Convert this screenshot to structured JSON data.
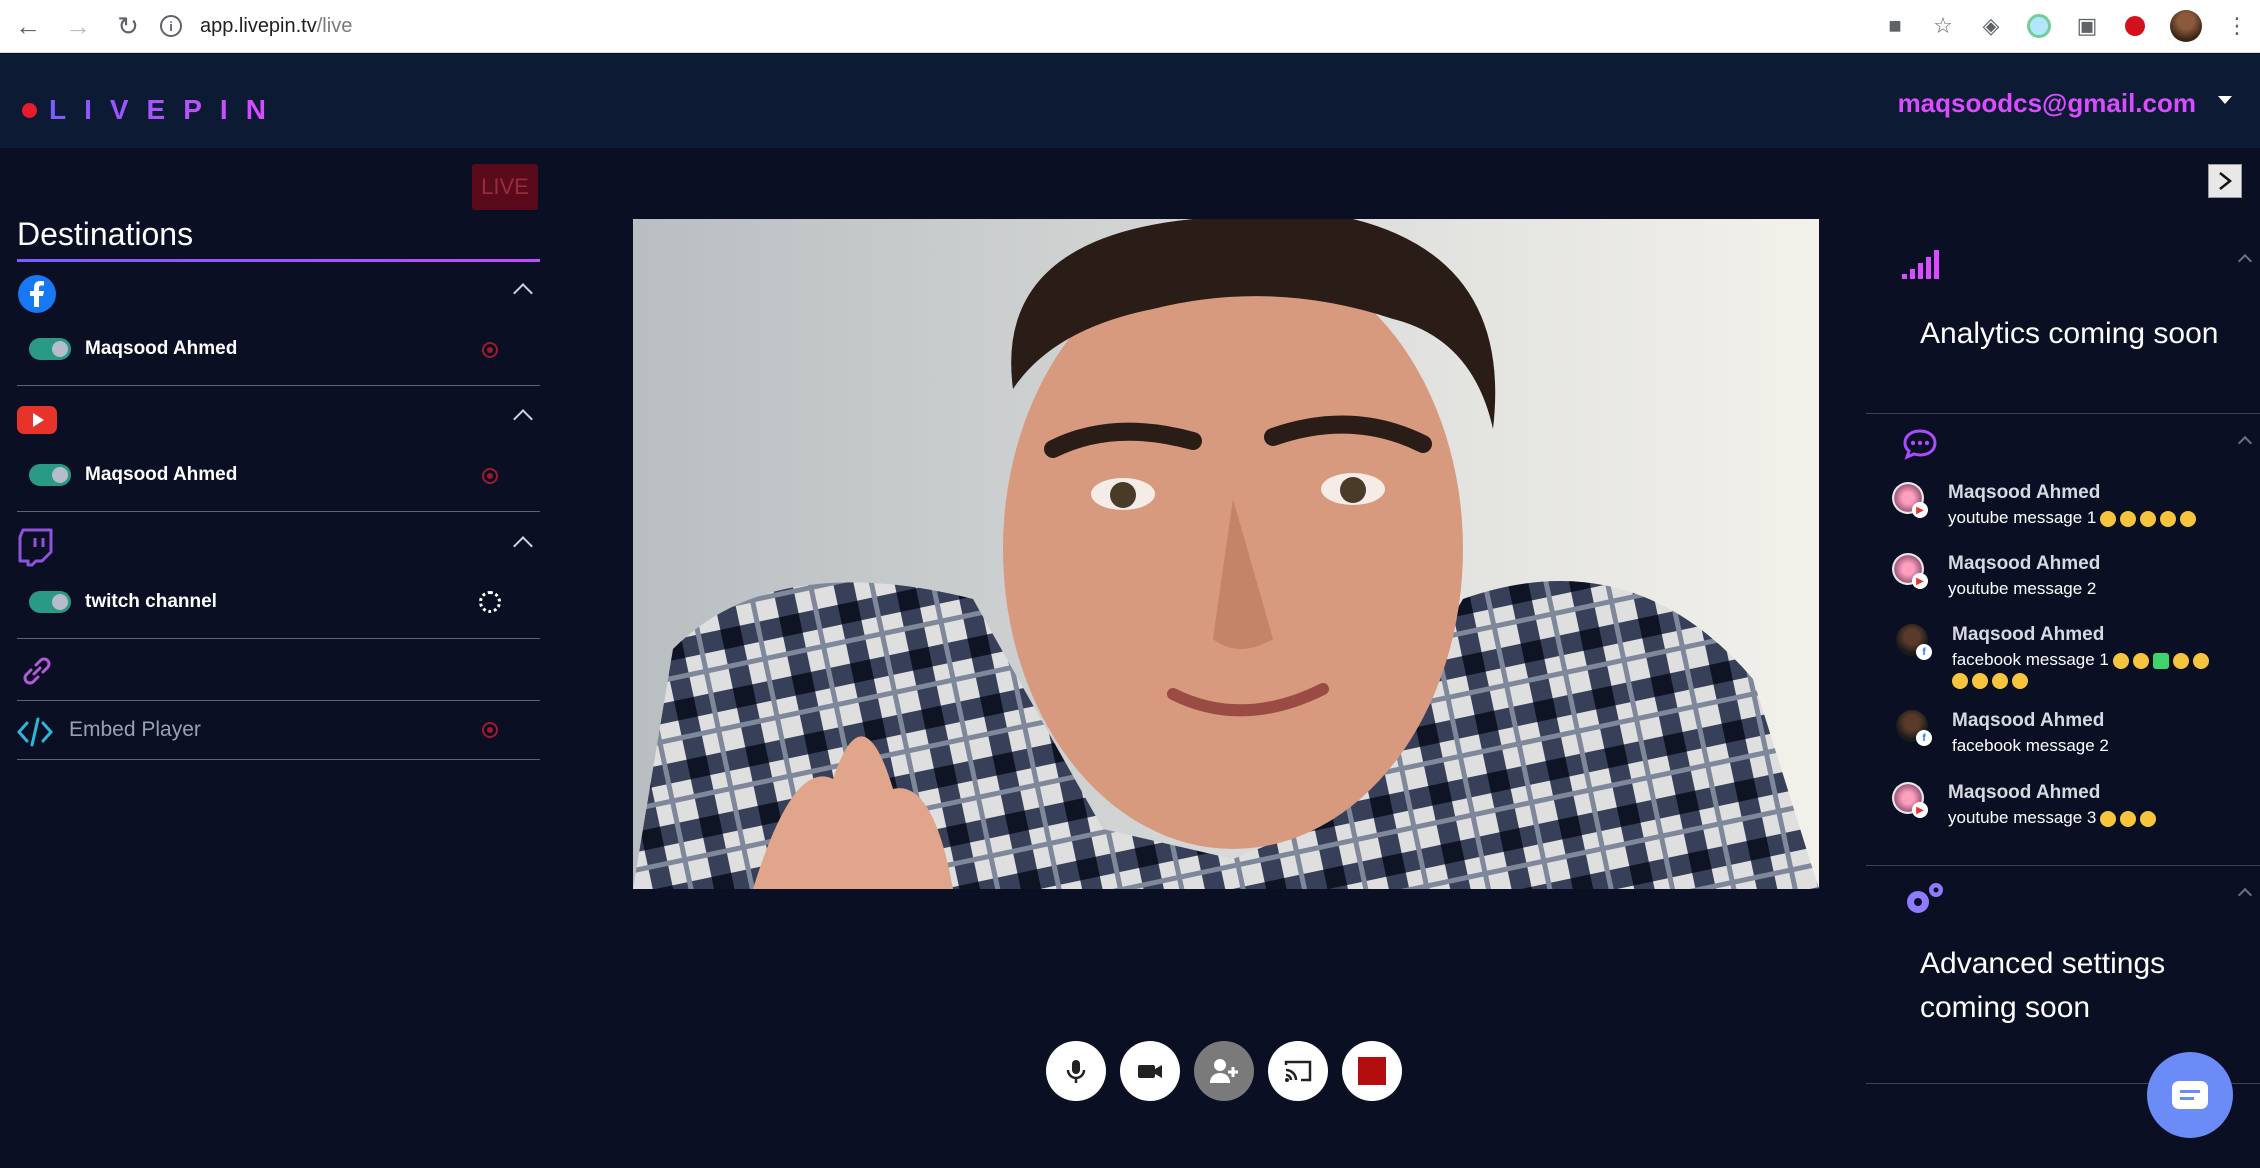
{
  "browser": {
    "url_host": "app.livepin.tv",
    "url_path": "/live"
  },
  "header": {
    "logo_text": "LIVEPIN",
    "user_email": "maqsoodcs@gmail.com"
  },
  "live_badge": "LIVE",
  "destinations": {
    "title": "Destinations",
    "platforms": [
      {
        "name": "facebook",
        "channel": "Maqsood Ahmed",
        "enabled": true,
        "status": "stopped"
      },
      {
        "name": "youtube",
        "channel": "Maqsood Ahmed",
        "enabled": true,
        "status": "stopped"
      },
      {
        "name": "twitch",
        "channel": "twitch channel",
        "enabled": true,
        "status": "connecting"
      }
    ],
    "embed_label": "Embed Player"
  },
  "controls": [
    "microphone",
    "camera",
    "add-guest",
    "cast",
    "stop"
  ],
  "analytics": {
    "text": "Analytics coming soon"
  },
  "chat": {
    "messages": [
      {
        "source": "youtube",
        "name": "Maqsood Ahmed",
        "text": "youtube message 1",
        "emoji_count": 5
      },
      {
        "source": "youtube",
        "name": "Maqsood Ahmed",
        "text": "youtube message 2",
        "emoji_count": 0
      },
      {
        "source": "facebook",
        "name": "Maqsood Ahmed",
        "text": "facebook message 1",
        "emoji_count": 10
      },
      {
        "source": "facebook",
        "name": "Maqsood Ahmed",
        "text": "facebook message 2",
        "emoji_count": 0
      },
      {
        "source": "youtube",
        "name": "Maqsood Ahmed",
        "text": "youtube message 3",
        "emoji_count": 3
      }
    ]
  },
  "advanced": {
    "line1": "Advanced settings",
    "line2": "coming soon"
  },
  "colors": {
    "background": "#0a0f24",
    "header": "#0c1a33",
    "accent_purple": "#d94cff",
    "toggle_on": "#2a9a86",
    "live_red": "#5a0b1b"
  }
}
